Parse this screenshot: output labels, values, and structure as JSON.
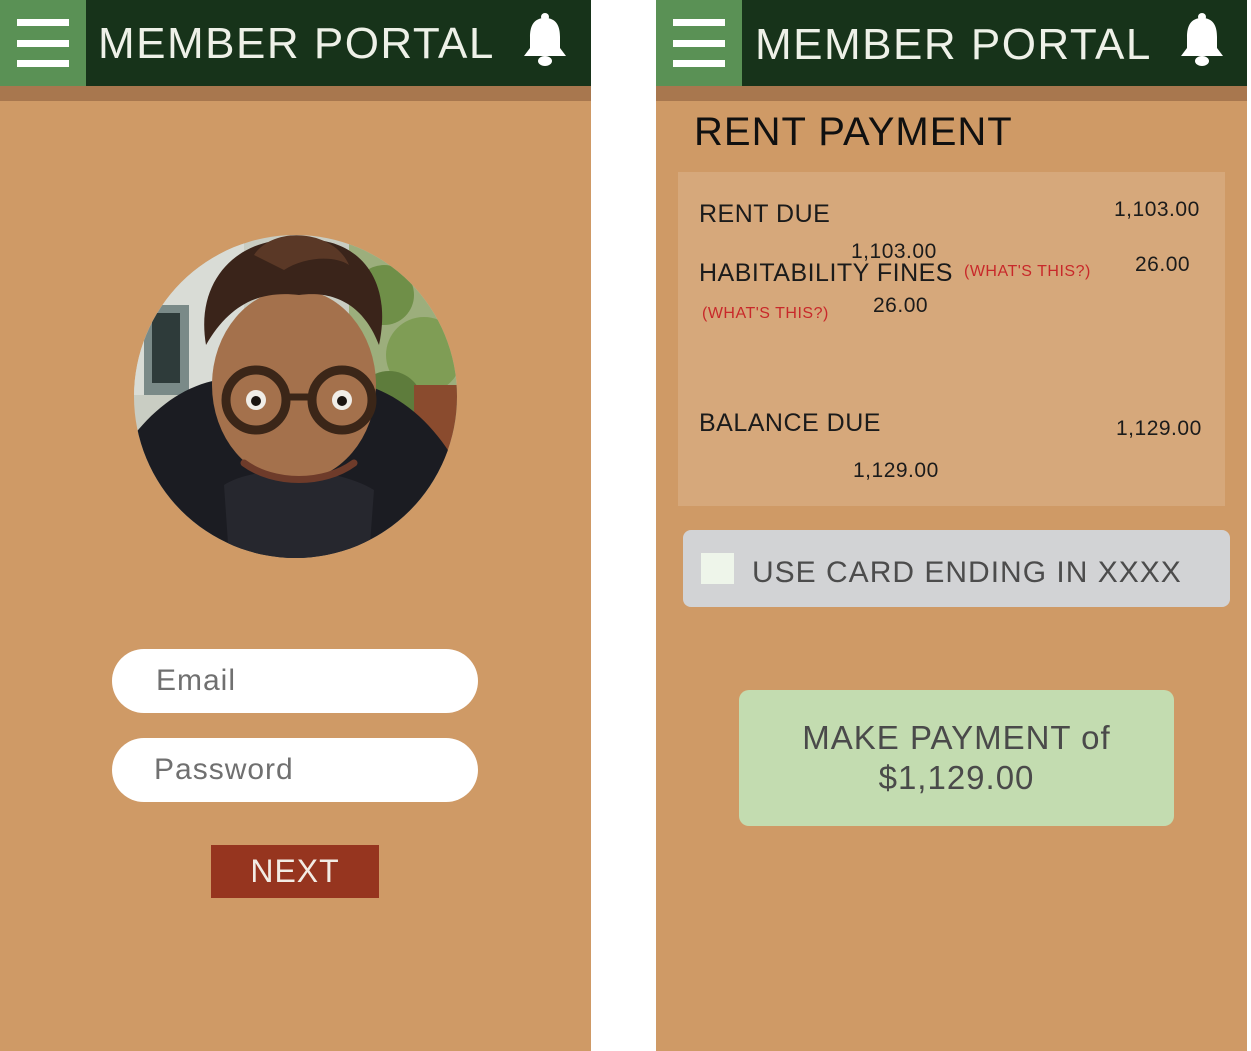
{
  "header": {
    "title": "MEMBER PORTAL"
  },
  "icons": {
    "menu": "hamburger-menu-icon",
    "notifications": "bell-icon"
  },
  "login": {
    "email_placeholder": "Email",
    "password_placeholder": "Password",
    "next_label": "NEXT"
  },
  "payment": {
    "title": "RENT PAYMENT",
    "rows": [
      {
        "label": "RENT DUE",
        "value": "1,103.00",
        "dup_value": "1,103.00"
      },
      {
        "label": "HABITABILITY FINES",
        "help": "(WHAT'S THIS?)",
        "value": "26.00",
        "dup_help": "(WHAT'S THIS?)",
        "dup_value": "26.00"
      },
      {
        "label": "BALANCE DUE",
        "value": "1,129.00",
        "dup_value": "1,129.00"
      }
    ],
    "card_option_label": "USE CARD ENDING IN XXXX",
    "pay_line1": "MAKE PAYMENT of",
    "pay_line2": "$1,129.00"
  },
  "colors": {
    "background": "#cf9a66",
    "topbar": "#17331a",
    "menu_button": "#5a9155",
    "next_button": "#96351f",
    "pay_button": "#c3dcb0",
    "help_link": "#c8282a"
  }
}
